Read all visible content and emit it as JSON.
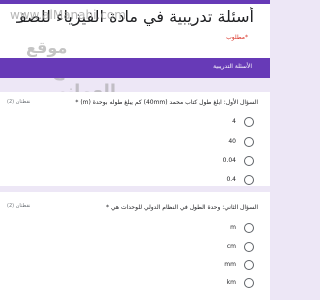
{
  "header": {
    "title": "أسئلة تدريبية في مادة الفيزياء للصف التاسع",
    "required_note": "*مطلوب"
  },
  "watermark": {
    "url": "www.alManahi.com",
    "line1": "موقع",
    "line2": "المناهج العماني"
  },
  "section": {
    "label": "الأسئلة التدريبية"
  },
  "questions": [
    {
      "text": "السؤال الأول: ابلغ طول كتاب محمد (40mm) كم يبلغ طوله بوحدة (m) *",
      "points": "نقطتان (2)",
      "options": [
        "4",
        "40",
        "0.04",
        "0.4"
      ]
    },
    {
      "text": "السؤال الثاني: وحدة الطول في النظام الدولي للوحدات هي *",
      "points": "نقطتان (2)",
      "options": [
        "m",
        "cm",
        "mm",
        "km"
      ]
    }
  ],
  "colors": {
    "accent": "#673ab7",
    "background": "#ede7f6",
    "required": "#d93025"
  }
}
